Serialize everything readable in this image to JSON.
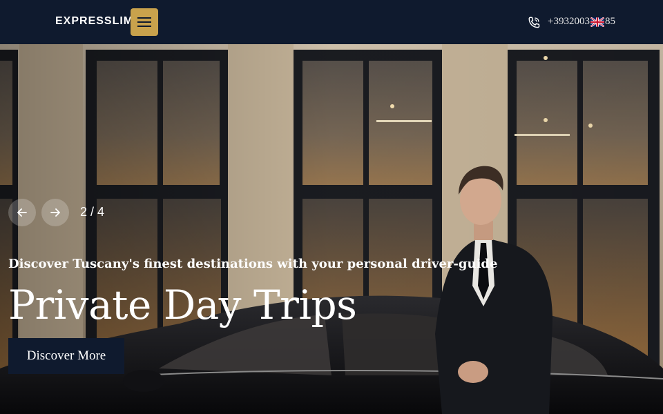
{
  "header": {
    "logo_text": "EXPRESSLIM",
    "menu_icon": "hamburger-icon",
    "phone_icon": "phone-icon",
    "phone_number": "+3932003",
    "phone_number_tail": "85",
    "language_flag": "uk-flag-icon"
  },
  "hero": {
    "slide_counter": "2 / 4",
    "prev_icon": "arrow-left-icon",
    "next_icon": "arrow-right-icon",
    "subtitle": "Discover Tuscany's finest destinations with your personal driver-guide",
    "title": "Private Day Trips",
    "cta_label": "Discover More"
  },
  "colors": {
    "navy": "#0f1a2e",
    "gold": "#c9a24c",
    "white": "#ffffff"
  }
}
